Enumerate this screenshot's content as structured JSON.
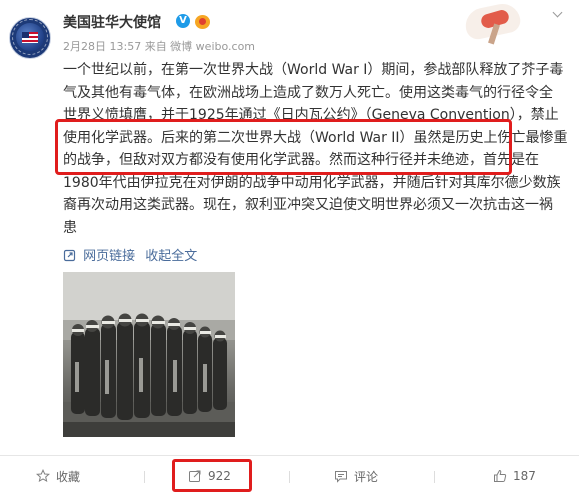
{
  "post": {
    "author": "美国驻华大使馆",
    "verified_icon": "verified-v-icon",
    "medal_icon": "medal-icon",
    "meta": "2月28日 13:57 来自 微博 weibo.com",
    "lines": [
      "一个世纪以前，在第一次世界大战（World War I）期间，参战部队释放了芥子毒",
      "气及其他有毒气体，在欧洲战场上造成了数万人死亡。使用这类毒气的行径令全",
      "世界义愤填膺，并于1925年通过《日内瓦公约》（Geneva Convention），禁止",
      "使用化学武器。后来的第二次世界大战（World War II）虽然是历史上伤亡最惨重",
      "的战争，但敌对双方都没有使用化学武器。然而这种行径并未绝迹，首先是在",
      "1980年代由伊拉克在对伊朗的战争中动用化学武器，并随后针对其库尔德少数族",
      "裔再次动用这类武器。现在，叙利亚冲突又迫使文明世界必须又一次抗击这一祸",
      "患"
    ],
    "web_link": "网页链接",
    "collapse": "收起全文"
  },
  "actions": {
    "favorite": "收藏",
    "share_count": "922",
    "comment": "评论",
    "like_count": "187"
  },
  "colors": {
    "highlight": "#e01d1d",
    "link": "#4a6c9b",
    "verified": "#1e9be8"
  }
}
